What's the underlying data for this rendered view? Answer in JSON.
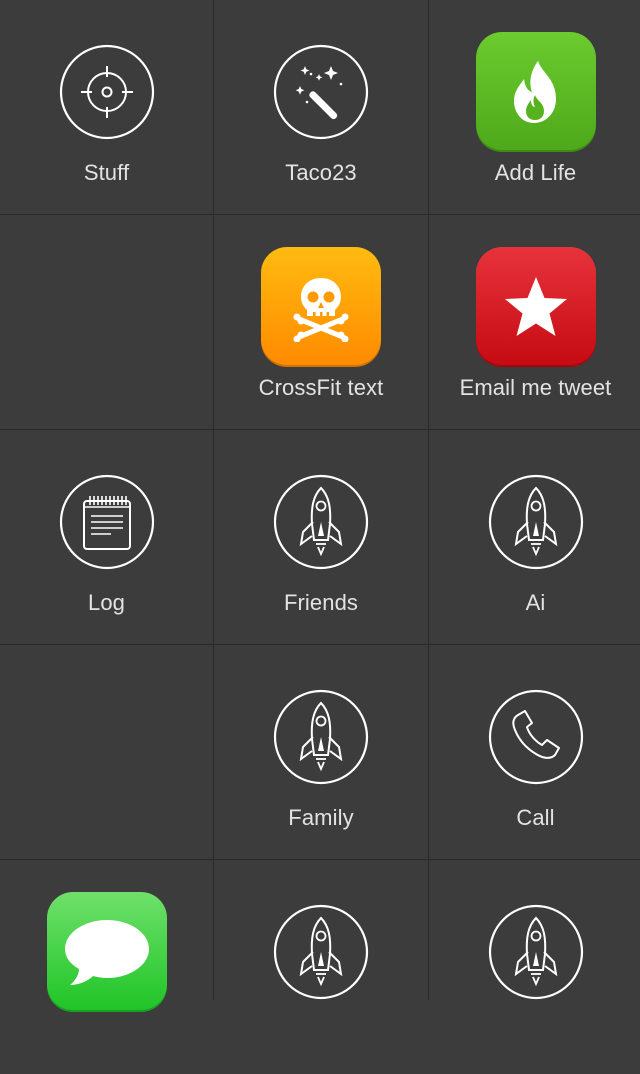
{
  "colors": {
    "background": "#3d3c3d",
    "grid_line": "#2a2a2a",
    "label_text": "#e3e3e3",
    "icon_stroke": "#ffffff"
  },
  "cells": [
    {
      "label": "Stuff",
      "icon": "crosshair-icon"
    },
    {
      "label": "Taco23",
      "icon": "magic-wand-icon"
    },
    {
      "label": "Add Life",
      "icon": "fire-icon"
    },
    {
      "label": "",
      "icon": ""
    },
    {
      "label": "CrossFit text",
      "icon": "skull-crossbones-icon"
    },
    {
      "label": "Email me tweet",
      "icon": "star-icon"
    },
    {
      "label": "Log",
      "icon": "notepad-icon"
    },
    {
      "label": "Friends",
      "icon": "rocket-icon"
    },
    {
      "label": "Ai",
      "icon": "rocket-icon"
    },
    {
      "label": "",
      "icon": ""
    },
    {
      "label": "Family",
      "icon": "rocket-icon"
    },
    {
      "label": "Call",
      "icon": "phone-icon"
    },
    {
      "label": "",
      "icon": "messages-icon"
    },
    {
      "label": "",
      "icon": "rocket-icon"
    },
    {
      "label": "",
      "icon": "rocket-icon"
    }
  ]
}
